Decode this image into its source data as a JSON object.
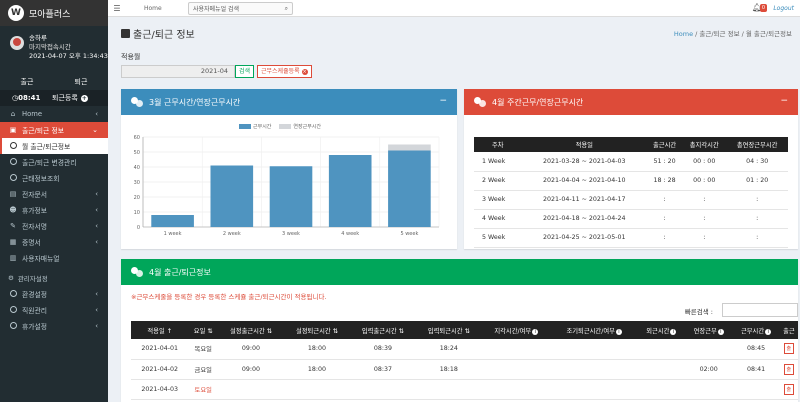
{
  "app": {
    "name": "모아플러스",
    "logo_letter": "W"
  },
  "user": {
    "name": "송하루",
    "last_login_label": "마지막접속시간",
    "last_login": "2021-04-07 오후 1:34:43"
  },
  "attendance_tabs": [
    "출근",
    "퇴근"
  ],
  "clock": {
    "time": "08:41",
    "register_label": "퇴근등록"
  },
  "menu": [
    {
      "label": "Home",
      "icon": "home-icon",
      "glyph": "⌂",
      "chev": "‹"
    },
    {
      "label": "출근/퇴근 정보",
      "icon": "calendar-icon",
      "glyph": "▣",
      "chev": "⌄",
      "state": "active"
    },
    {
      "label": "월 출근/퇴근정보",
      "icon": "circle-icon",
      "glyph": "",
      "chev": "",
      "state": "sub"
    },
    {
      "label": "출근/퇴근 변경관리",
      "icon": "circle-icon",
      "glyph": "",
      "chev": ""
    },
    {
      "label": "근태정보조회",
      "icon": "circle-icon",
      "glyph": "",
      "chev": ""
    },
    {
      "label": "전자문서",
      "icon": "document-icon",
      "glyph": "▤",
      "chev": "‹"
    },
    {
      "label": "휴가정보",
      "icon": "users-icon",
      "glyph": "☻",
      "chev": "‹"
    },
    {
      "label": "전자서명",
      "icon": "sign-icon",
      "glyph": "✎",
      "chev": "‹"
    },
    {
      "label": "증명서",
      "icon": "certificate-icon",
      "glyph": "▦",
      "chev": "‹"
    },
    {
      "label": "사용자매뉴얼",
      "icon": "book-icon",
      "glyph": "▥",
      "chev": ""
    }
  ],
  "admin_section": "관리자설정",
  "admin_menu": [
    {
      "label": "환경설정",
      "icon": "circle-icon"
    },
    {
      "label": "직원관리",
      "icon": "circle-icon"
    },
    {
      "label": "휴가설정",
      "icon": "circle-icon"
    }
  ],
  "topbar": {
    "home": "Home",
    "search_placeholder": "사용자메뉴얼 검색",
    "bell_count": "0",
    "logout": "Logout"
  },
  "page": {
    "title": "출근/퇴근 정보",
    "breadcrumb_home": "Home",
    "breadcrumb_rest": " / 출근/퇴근 정보 / 월 출근/퇴근정보"
  },
  "filter": {
    "label": "적용월",
    "value": "2021-04",
    "search_btn": "검색",
    "schedule_btn": "근무스케쥴등록"
  },
  "chart_box": {
    "title": "3월 근무시간/연장근무시간"
  },
  "chart_data": {
    "type": "bar",
    "categories": [
      "1 week",
      "2 week",
      "3 week",
      "4 week",
      "5 week"
    ],
    "series": [
      {
        "name": "근무시간",
        "values": [
          8,
          41,
          40.5,
          48,
          51
        ],
        "color": "#4f94c0"
      },
      {
        "name": "연장근무시간",
        "values": [
          0,
          0,
          0,
          0,
          4
        ],
        "color": "#d3d6da"
      }
    ],
    "ylim": [
      0,
      60
    ],
    "yticks": [
      0,
      10,
      20,
      30,
      40,
      50,
      60
    ],
    "stacked": true,
    "legend_position": "top",
    "grid": true
  },
  "weekly_box": {
    "title": "4월 주간근무/연장근무시간",
    "headers": [
      "주차",
      "적용일",
      "출근시간",
      "총지각시간",
      "총연장근무시간"
    ],
    "rows": [
      [
        "1 Week",
        "2021-03-28 ~ 2021-04-03",
        "51 : 20",
        "00 : 00",
        "04 : 30"
      ],
      [
        "2 Week",
        "2021-04-04 ~ 2021-04-10",
        "18 : 28",
        "00 : 00",
        "01 : 20"
      ],
      [
        "3 Week",
        "2021-04-11 ~ 2021-04-17",
        ":",
        ":",
        ":"
      ],
      [
        "4 Week",
        "2021-04-18 ~ 2021-04-24",
        ":",
        ":",
        ":"
      ],
      [
        "5 Week",
        "2021-04-25 ~ 2021-05-01",
        ":",
        ":",
        ":"
      ]
    ]
  },
  "detail_box": {
    "title": "4월 출근/퇴근정보",
    "notice": "※근무스케줄을 등록한 경우 등록한 스케쥴 출근/퇴근시간이 적용됩니다.",
    "quick_search": "빠른검색 :",
    "headers": [
      "적용일",
      "요일",
      "설정출근시간",
      "설정퇴근시간",
      "입력출근시간",
      "입력퇴근시간",
      "지각시간/여부",
      "조기퇴근시간/여부",
      "외근시간",
      "연장근무",
      "근무시간",
      "출근"
    ],
    "rows": [
      {
        "cells": [
          "2021-04-01",
          "목요일",
          "09:00",
          "18:00",
          "08:39",
          "18:24",
          "",
          "",
          "",
          "",
          "08:45",
          "출"
        ],
        "weekend": false
      },
      {
        "cells": [
          "2021-04-02",
          "금요일",
          "09:00",
          "18:00",
          "08:37",
          "18:18",
          "",
          "",
          "",
          "02:00",
          "08:41",
          "출"
        ],
        "weekend": false
      },
      {
        "cells": [
          "2021-04-03",
          "토요일",
          "",
          "",
          "",
          "",
          "",
          "",
          "",
          "",
          "",
          "출"
        ],
        "weekend": true
      }
    ]
  }
}
